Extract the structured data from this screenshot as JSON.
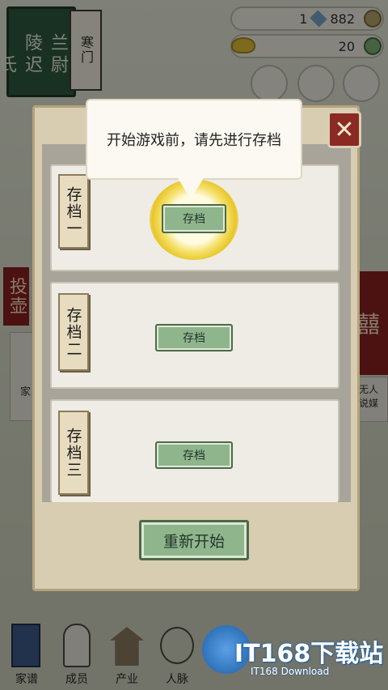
{
  "background": {
    "banner_left": "兰陵",
    "banner_right": "尉迟氏",
    "banner_title": "寒门",
    "currency_1": "1",
    "currency_2": "882",
    "currency_3": "20",
    "side_left": "投壶",
    "side_left_small": "家",
    "side_right_small_1": "无人",
    "side_right_small_2": "说媒",
    "side_right_big": "囍",
    "nav": [
      "家谱",
      "成员",
      "产业",
      "人脉"
    ]
  },
  "dialog": {
    "tooltip": "开始游戏前，请先进行存档",
    "close_label": "✕",
    "slots": [
      {
        "name": "存档一",
        "button": "存档"
      },
      {
        "name": "存档二",
        "button": "存档"
      },
      {
        "name": "存档三",
        "button": "存档"
      }
    ],
    "restart_label": "重新开始"
  },
  "watermark": {
    "main": "IT168下载站",
    "sub": "IT168 Download"
  },
  "colors": {
    "panel": "#d8cdb1",
    "button": "#8fb58d",
    "close": "#8a2a22",
    "banner": "#2f5a3e"
  }
}
